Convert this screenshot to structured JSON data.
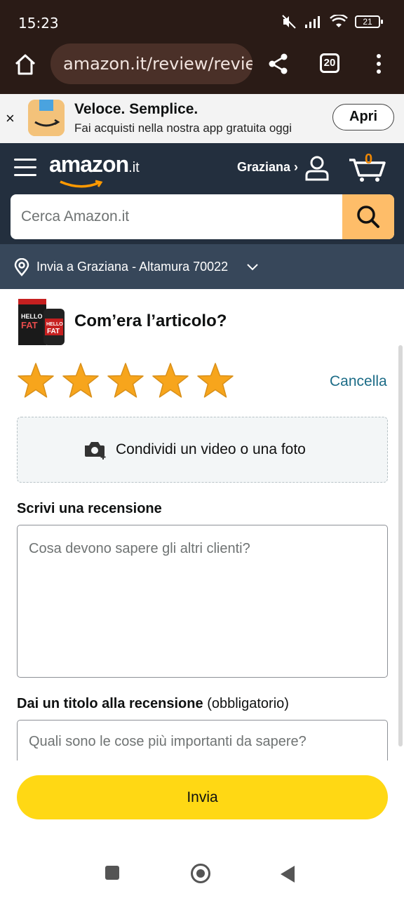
{
  "status_bar": {
    "time": "15:23",
    "battery": "21"
  },
  "browser": {
    "url": "amazon.it/review/revie",
    "tab_count": "20"
  },
  "app_banner": {
    "title": "Veloce. Semplice.",
    "subtitle": "Fai acquisti nella nostra app gratuita oggi",
    "open_label": "Apri",
    "close_label": "×"
  },
  "header": {
    "logo": "amazon",
    "logo_suffix": ".it",
    "user_name": "Graziana ›",
    "cart_count": "0",
    "search_placeholder": "Cerca Amazon.it",
    "deliver_to": "Invia a Graziana - Altamura 70022"
  },
  "product": {
    "image_text_top": "HELLO",
    "image_text_bottom": "FAT",
    "question": "Com’era l’articolo?"
  },
  "rating": {
    "stars_filled": 5,
    "stars_total": 5,
    "star_color": "#f7a51c",
    "clear_label": "Cancella"
  },
  "upload": {
    "label": "Condividi un video o una foto"
  },
  "review": {
    "label": "Scrivi una recensione",
    "placeholder": "Cosa devono sapere gli altri clienti?"
  },
  "title_field": {
    "label": "Dai un titolo alla recensione",
    "label_note": "(obbligatorio)",
    "placeholder": "Quali sono le cose più importanti da sapere?"
  },
  "submit": {
    "label": "Invia",
    "color": "#ffd814"
  },
  "colors": {
    "header_bg": "#232f3e",
    "deliver_bg": "#37475a",
    "browser_bg": "#2a1b16",
    "link": "#1c6c87"
  }
}
